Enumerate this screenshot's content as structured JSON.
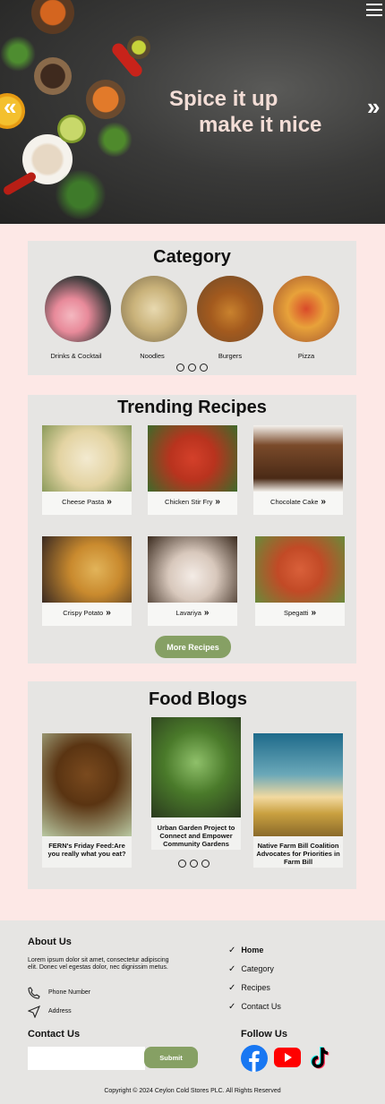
{
  "hero": {
    "line1": "Spice it up",
    "line2": "make it nice",
    "prev_symbol": "«",
    "next_symbol": "»"
  },
  "category": {
    "title": "Category",
    "items": [
      {
        "label": "Drinks & Cocktail"
      },
      {
        "label": "Noodles"
      },
      {
        "label": "Burgers"
      },
      {
        "label": "Pizza"
      }
    ]
  },
  "recipes": {
    "title": "Trending Recipes",
    "items": [
      {
        "label": "Cheese Pasta"
      },
      {
        "label": "Chicken Stir Fry"
      },
      {
        "label": "Chocolate Cake"
      },
      {
        "label": "Crispy Potato"
      },
      {
        "label": "Lavariya"
      },
      {
        "label": "Spegatti"
      }
    ],
    "more_label": "More Recipes"
  },
  "blogs": {
    "title": "Food Blogs",
    "items": [
      {
        "title": "FERN's Friday Feed:Are you really what you eat?"
      },
      {
        "title": "Urban Garden Project to Connect and Empower Community Gardens"
      },
      {
        "title": "Native Farm Bill Coalition Advocates for Priorities in Farm Bill"
      }
    ]
  },
  "footer": {
    "about_title": "About Us",
    "about_text": "Lorem ipsum dolor sit amet, consectetur adipiscing elit. Donec vel egestas dolor, nec dignissim metus.",
    "phone": "Phone Number",
    "address": "Address",
    "links": [
      {
        "label": "Home"
      },
      {
        "label": "Category"
      },
      {
        "label": "Recipes"
      },
      {
        "label": "Contact Us"
      }
    ],
    "contact_title": "Contact Us",
    "submit_label": "Submit",
    "follow_title": "Follow Us",
    "copyright": "Copyright © 2024 Ceylon Cold Stores PLC. All Rights Reserved"
  },
  "colors": {
    "accent_green": "#86a064",
    "page_bg": "#fde8e6",
    "panel_bg": "#e6e5e3"
  }
}
